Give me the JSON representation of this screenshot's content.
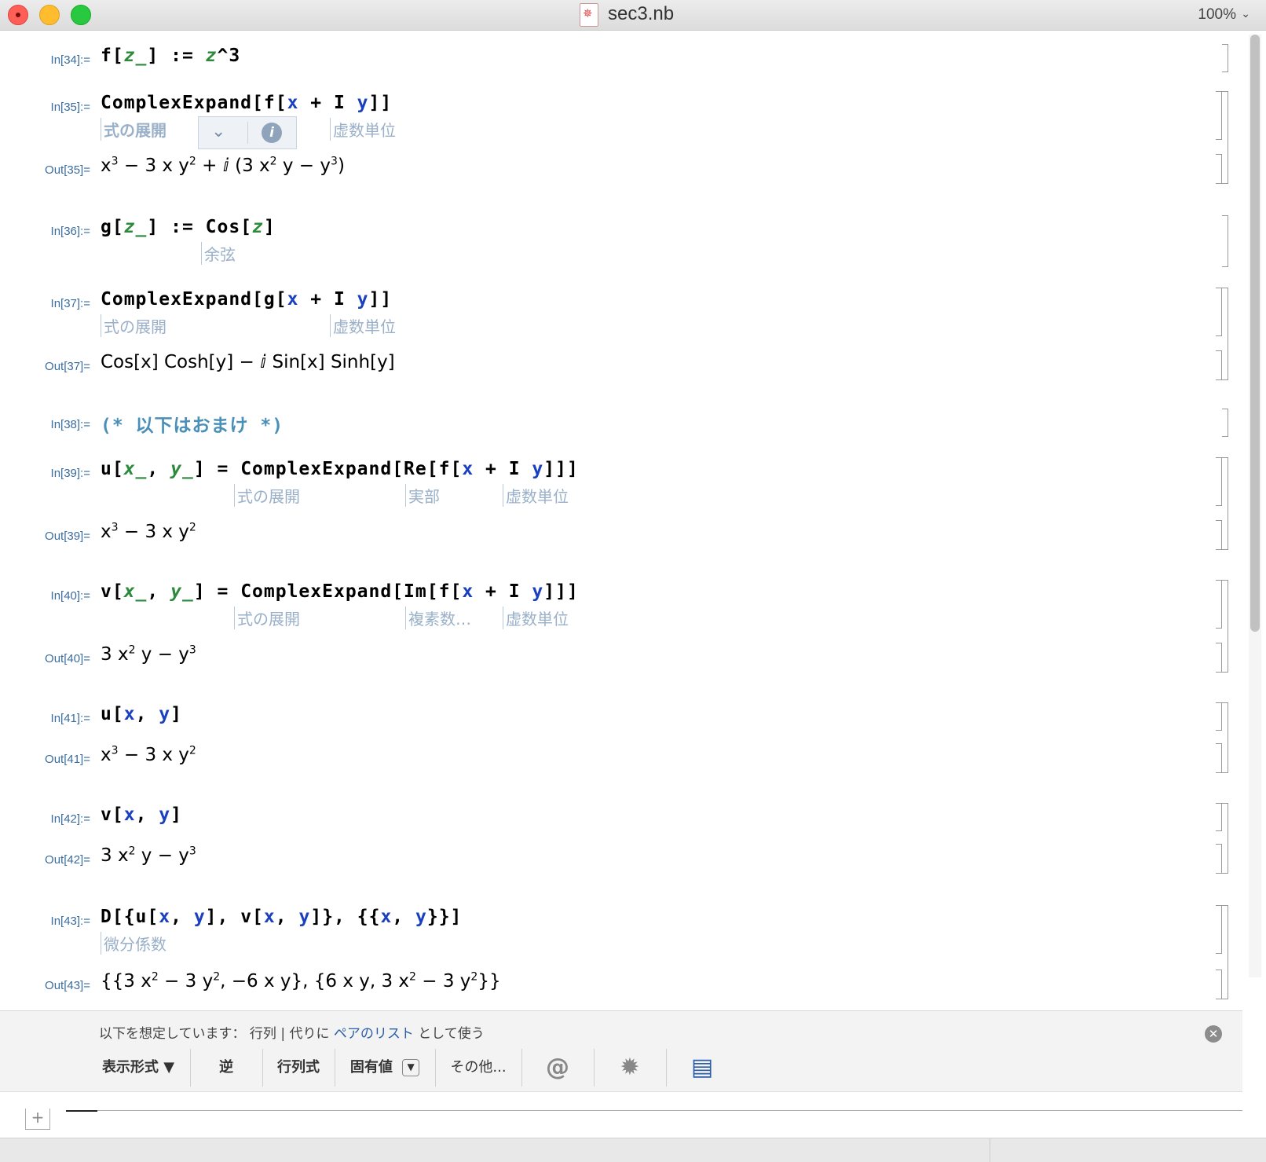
{
  "window": {
    "title": "sec3.nb",
    "zoom": "100%"
  },
  "cells": {
    "in34": {
      "label": "In[34]:="
    },
    "in35": {
      "label": "In[35]:=",
      "hints": [
        "式の展開",
        "虚数単位"
      ]
    },
    "out35": {
      "label": "Out[35]="
    },
    "in36": {
      "label": "In[36]:=",
      "hints": [
        "余弦"
      ]
    },
    "in37": {
      "label": "In[37]:=",
      "hints": [
        "式の展開",
        "虚数単位"
      ]
    },
    "out37": {
      "label": "Out[37]=",
      "text": "Cos[x] Cosh[y] − ⅈ Sin[x] Sinh[y]"
    },
    "in38": {
      "label": "In[38]:=",
      "text": "(* 以下はおまけ *)"
    },
    "in39": {
      "label": "In[39]:=",
      "hints": [
        "式の展開",
        "実部",
        "虚数単位"
      ]
    },
    "out39": {
      "label": "Out[39]="
    },
    "in40": {
      "label": "In[40]:=",
      "hints": [
        "式の展開",
        "複素数…",
        "虚数単位"
      ]
    },
    "out40": {
      "label": "Out[40]="
    },
    "in41": {
      "label": "In[41]:="
    },
    "out41": {
      "label": "Out[41]="
    },
    "in42": {
      "label": "In[42]:="
    },
    "out42": {
      "label": "Out[42]="
    },
    "in43": {
      "label": "In[43]:=",
      "hints": [
        "微分係数"
      ]
    },
    "out43": {
      "label": "Out[43]="
    }
  },
  "suggestions": {
    "assume_prefix": "以下を想定しています：",
    "assume_value": "行列",
    "assume_sep": "|",
    "assume_instead": "代りに",
    "assume_link": "ペアのリスト",
    "assume_suffix": "として使う",
    "buttons": {
      "display_form": "表示形式 ▼",
      "inverse": "逆",
      "determinant": "行列式",
      "eigenvalues": "固有値",
      "more": "その他..."
    }
  },
  "colors": {
    "label": "#3a6d9e",
    "pattern_var": "#2c8a3c",
    "global_symbol": "#1a3fbf",
    "hint": "#9ab0c8",
    "link": "#2b5ea8"
  }
}
